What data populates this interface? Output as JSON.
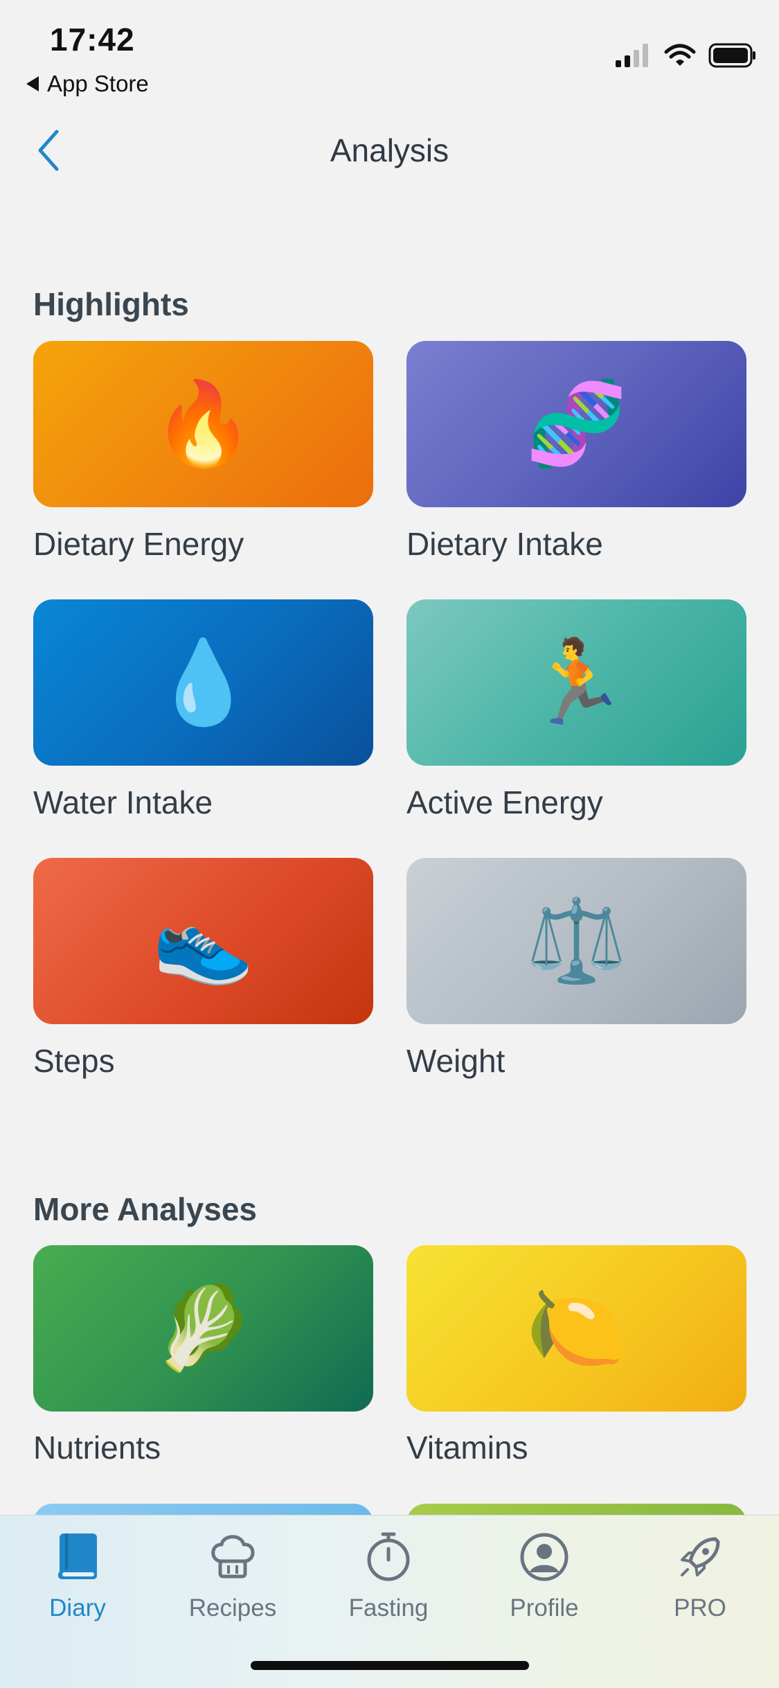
{
  "status_bar": {
    "time": "17:42",
    "back_label": "App Store"
  },
  "nav": {
    "title": "Analysis"
  },
  "highlights": {
    "title": "Highlights",
    "cards": [
      {
        "label": "Dietary Energy",
        "emoji": "🔥"
      },
      {
        "label": "Dietary Intake",
        "emoji": "🧬"
      },
      {
        "label": "Water Intake",
        "emoji": "💧"
      },
      {
        "label": "Active Energy",
        "emoji": "🏃"
      },
      {
        "label": "Steps",
        "emoji": "👟"
      },
      {
        "label": "Weight",
        "emoji": "⚖️"
      }
    ]
  },
  "more": {
    "title": "More Analyses",
    "cards": [
      {
        "label": "Nutrients",
        "emoji": "🥬"
      },
      {
        "label": "Vitamins",
        "emoji": "🍋"
      }
    ]
  },
  "tabbar": {
    "items": [
      {
        "label": "Diary",
        "icon": "book-icon",
        "active": true
      },
      {
        "label": "Recipes",
        "icon": "chef-hat-icon"
      },
      {
        "label": "Fasting",
        "icon": "stopwatch-icon"
      },
      {
        "label": "Profile",
        "icon": "user-icon"
      },
      {
        "label": "PRO",
        "icon": "rocket-icon"
      }
    ]
  },
  "colors": {
    "accent": "#1f87c9",
    "background": "#f2f2f2"
  }
}
